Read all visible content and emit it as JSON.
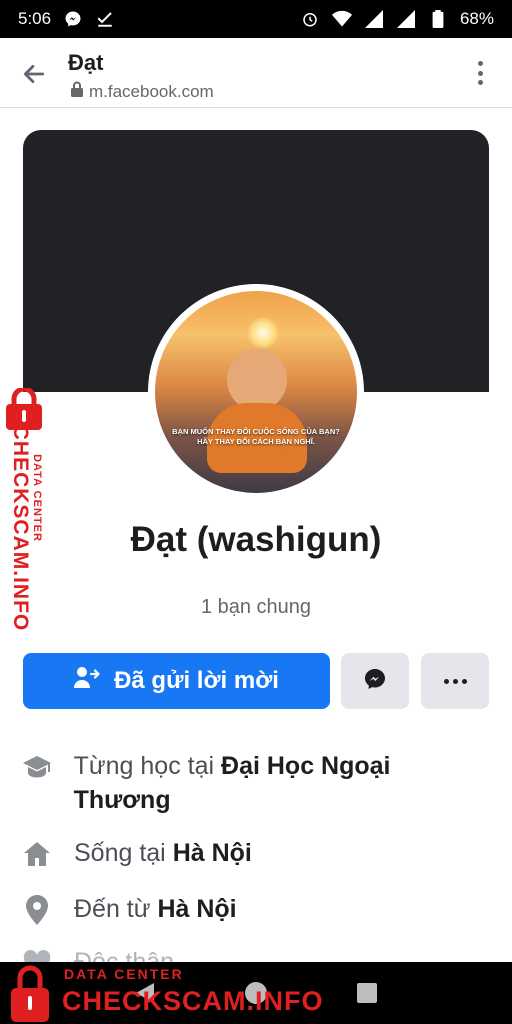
{
  "status_bar": {
    "time": "5:06",
    "battery": "68%",
    "icons": [
      "messenger-icon",
      "download-done-icon",
      "alarm-icon",
      "wifi-icon",
      "signal-icon",
      "battery-icon"
    ]
  },
  "browser": {
    "title": "Đạt",
    "url": "m.facebook.com"
  },
  "profile": {
    "name": "Đạt (washigun)",
    "mutual_friends": "1 bạn chung",
    "avatar_quote": "BẠN MUỐN THAY ĐỔI CUỘC SỐNG CỦA BẠN? HÃY THAY ĐỔI CÁCH BẠN NGHĨ."
  },
  "actions": {
    "primary_label": "Đã gửi lời mời"
  },
  "info": {
    "education_prefix": "Từng học tại",
    "education_value": "Đại Học Ngoại Thương",
    "lives_prefix": "Sống tại",
    "lives_value": "Hà Nội",
    "from_prefix": "Đến từ",
    "from_value": "Hà Nội",
    "relationship_partial": "Độc thân"
  },
  "watermark": {
    "top_text": "DATA CENTER",
    "main_text": "CHECKSCAM.INFO"
  },
  "colors": {
    "primary": "#1877f2",
    "watermark": "#e02020"
  }
}
